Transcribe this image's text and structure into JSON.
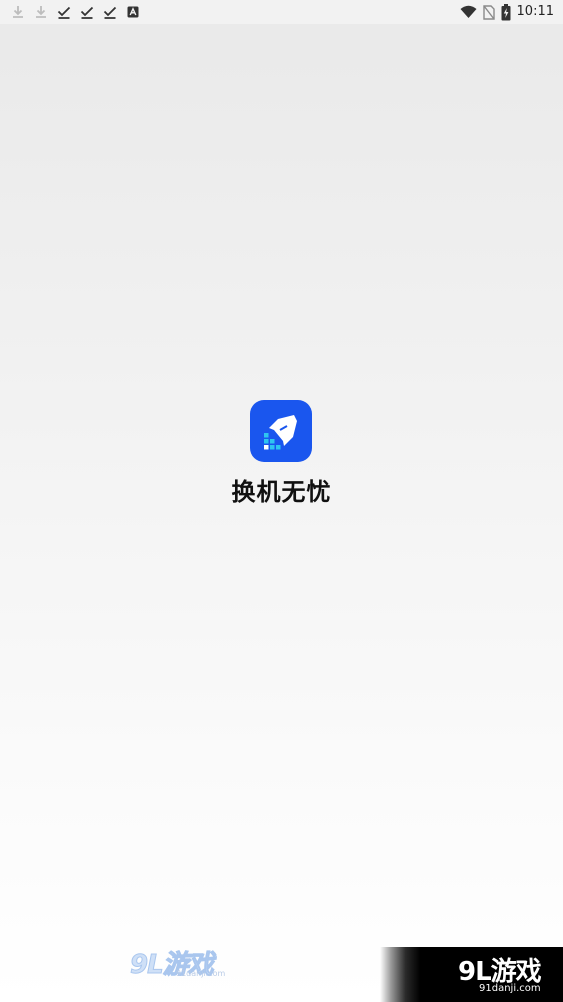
{
  "status_bar": {
    "time": "10:11",
    "left_icons": [
      "download-icon",
      "download-icon",
      "check-icon",
      "check-icon",
      "check-icon",
      "a-box-icon"
    ],
    "right_icons": [
      "wifi-icon",
      "no-sim-icon",
      "battery-charging-icon"
    ]
  },
  "splash": {
    "app_name": "换机无忧",
    "icon": "rocket-icon",
    "icon_color": "#1a56ee",
    "accent_color": "#2ec5f0"
  },
  "watermarks": {
    "left": {
      "logo": "9L游戏",
      "url": "91danji.com"
    },
    "right": {
      "logo": "9L游戏",
      "url": "91danji.com"
    }
  }
}
